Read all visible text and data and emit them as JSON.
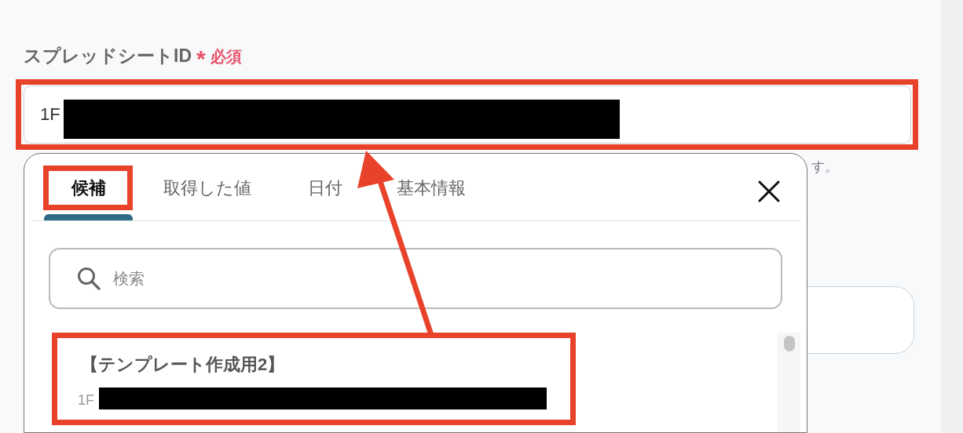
{
  "form": {
    "label": "スプレッドシートID",
    "required_mark": "*",
    "required_text": "必須",
    "value": "1F",
    "hint": "す。"
  },
  "popup": {
    "tabs": [
      {
        "label": "候補",
        "selected": true
      },
      {
        "label": "取得した値",
        "selected": false
      },
      {
        "label": "日付",
        "selected": false
      },
      {
        "label": "基本情報",
        "selected": false
      }
    ],
    "search": {
      "placeholder": "検索"
    },
    "candidates": [
      {
        "title": "【テンプレート作成用2】",
        "id": "1F"
      }
    ]
  }
}
